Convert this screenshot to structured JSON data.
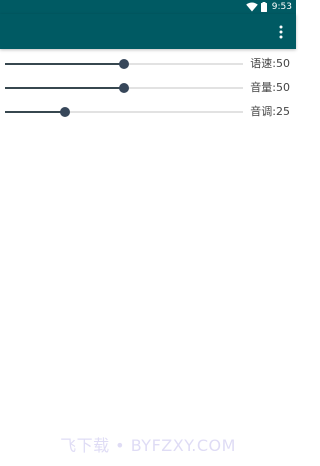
{
  "status_bar": {
    "time": "9:53",
    "background": "#005a63",
    "icons": [
      "wifi-icon",
      "battery-icon"
    ]
  },
  "app_bar": {
    "background": "#005a63",
    "menu_icon": "more-vert-icon"
  },
  "sliders": [
    {
      "label": "语速:50",
      "value": 50,
      "max": 100
    },
    {
      "label": "音量:50",
      "value": 50,
      "max": 100
    },
    {
      "label": "音调:25",
      "value": 25,
      "max": 100
    }
  ],
  "watermark": "飞下载 • BYFZXY.COM",
  "colors": {
    "accent": "#37475a",
    "track": "#e2e2e2"
  }
}
